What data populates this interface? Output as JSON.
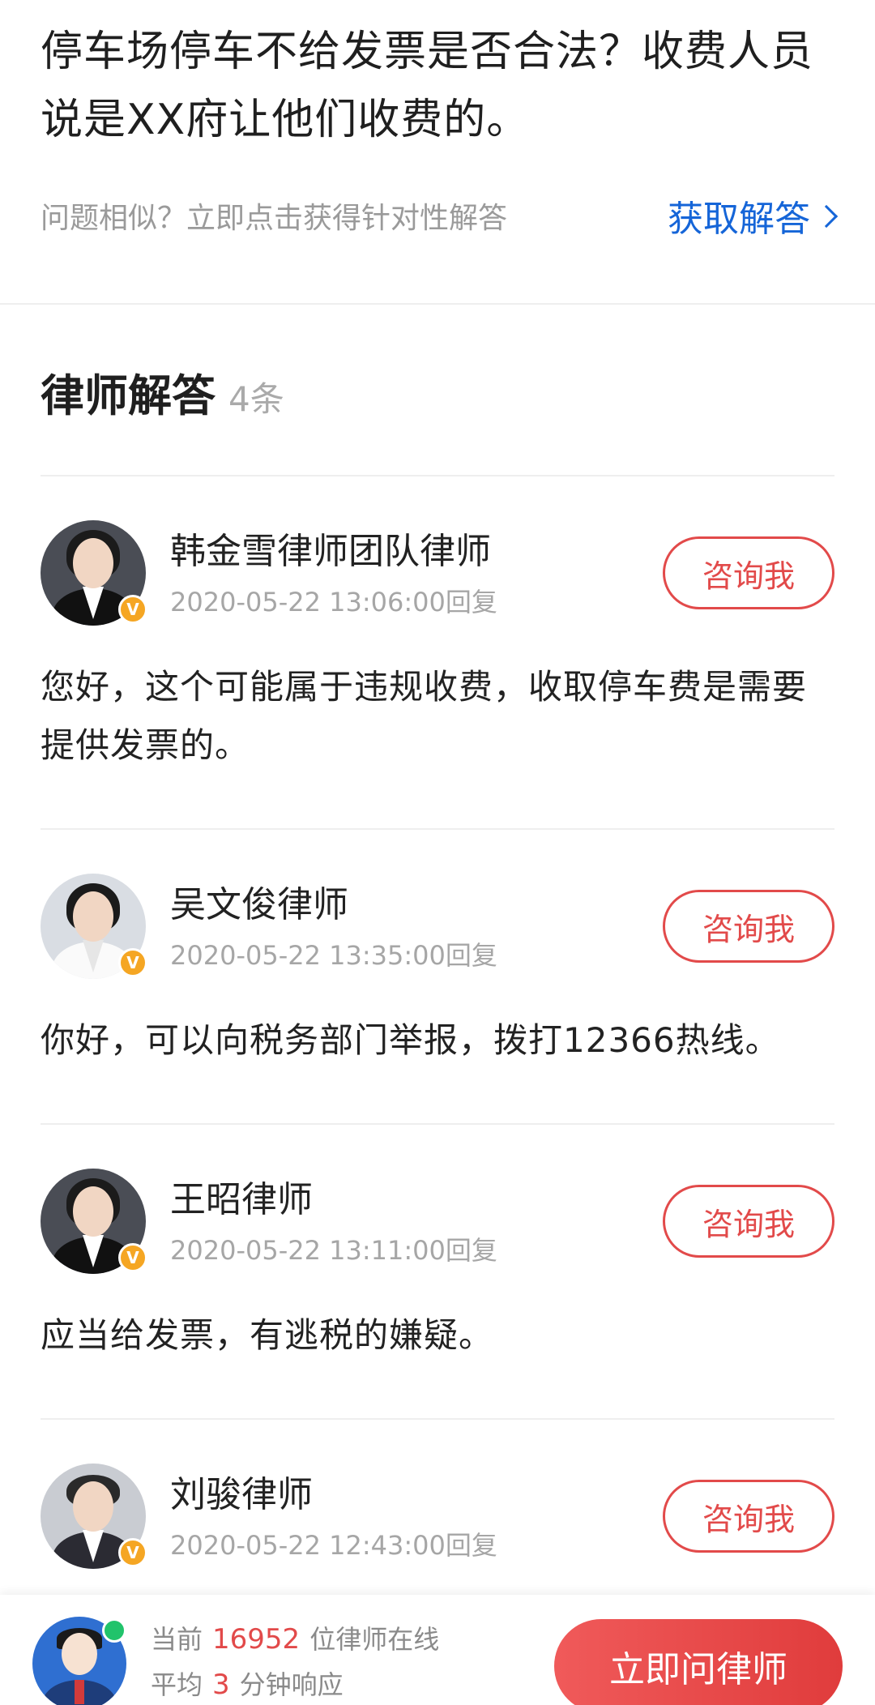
{
  "question": {
    "title": "停车场停车不给发票是否合法？收费人员说是XX府让他们收费的。",
    "hint": "问题相似？立即点击获得针对性解答",
    "link_label": "获取解答"
  },
  "answers_section": {
    "title": "律师解答",
    "count": "4条"
  },
  "answers": [
    {
      "name": "韩金雪律师团队律师",
      "time": "2020-05-22 13:06:00回复",
      "consult_label": "咨询我",
      "text": "您好，这个可能属于违规收费，收取停车费是需要提供发票的。",
      "verified_badge": "V"
    },
    {
      "name": "吴文俊律师",
      "time": "2020-05-22 13:35:00回复",
      "consult_label": "咨询我",
      "text": "你好，可以向税务部门举报，拨打12366热线。",
      "verified_badge": "V"
    },
    {
      "name": "王昭律师",
      "time": "2020-05-22 13:11:00回复",
      "consult_label": "咨询我",
      "text": "应当给发票，有逃税的嫌疑。",
      "verified_badge": "V"
    },
    {
      "name": "刘骏律师",
      "time": "2020-05-22 12:43:00回复",
      "consult_label": "咨询我",
      "verified_badge": "V"
    }
  ],
  "bottom_bar": {
    "line1_prefix": "当前",
    "online_count": "16952",
    "line1_suffix": "位律师在线",
    "line2_prefix": "平均",
    "response_minutes": "3",
    "line2_suffix": "分钟响应",
    "ask_button": "立即问律师"
  },
  "colors": {
    "accent_red": "#e24a4a",
    "link_blue": "#1565d8",
    "badge_orange": "#f5a623",
    "online_green": "#21c36b"
  }
}
